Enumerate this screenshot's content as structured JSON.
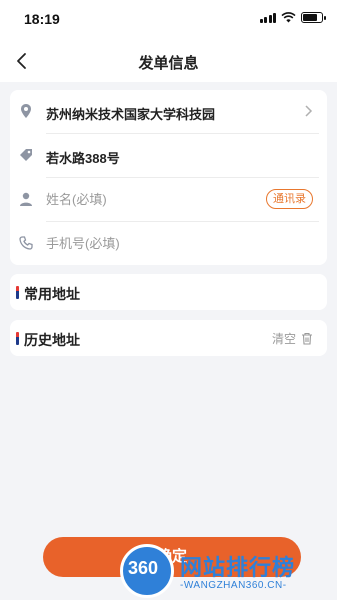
{
  "status_bar": {
    "time": "18:19",
    "battery_level": 0.85
  },
  "navbar": {
    "title": "发单信息",
    "back_icon": "chevron-left-icon"
  },
  "address_card": {
    "address": "苏州纳米技术国家大学科技园",
    "address_icon": "location-pin-icon",
    "detail": "若水路388号",
    "detail_icon": "tag-icon",
    "name_placeholder": "姓名(必填)",
    "name_icon": "person-icon",
    "contacts_label": "通讯录",
    "phone_placeholder": "手机号(必填)",
    "phone_icon": "phone-icon"
  },
  "common_address": {
    "title": "常用地址"
  },
  "history_address": {
    "title": "历史地址",
    "clear_label": "清空",
    "clear_icon": "trash-icon"
  },
  "bottom_button": {
    "label": "确定"
  },
  "watermark": {
    "logo_text": "360",
    "name": "网站排行榜",
    "url": "-WANGZHAN360.CN-"
  },
  "colors": {
    "accent": "#e8622a",
    "contacts_border": "#e8772e",
    "background": "#f3f4f7",
    "watermark_blue": "#2f80d8"
  }
}
